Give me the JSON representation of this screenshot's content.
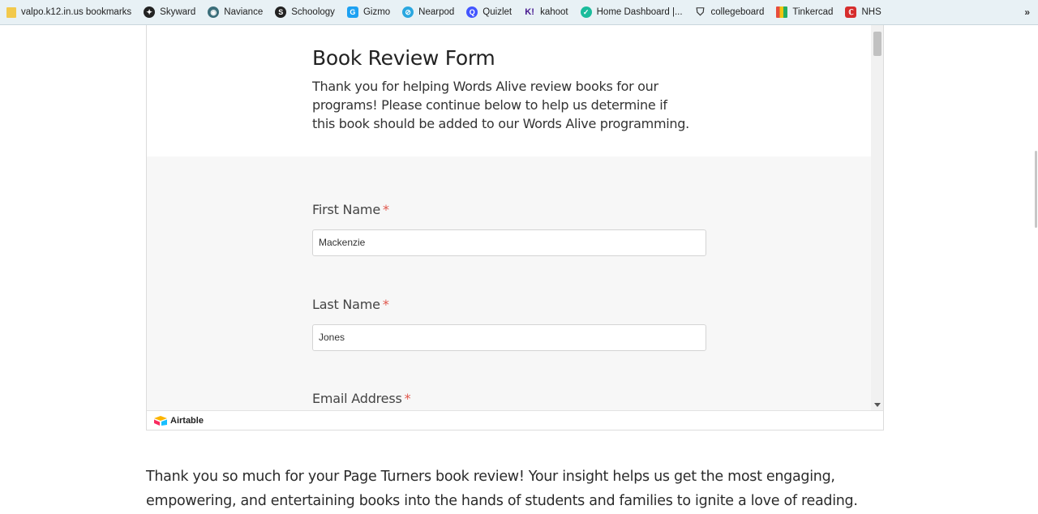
{
  "bookmarks": [
    {
      "label": "valpo.k12.in.us bookmarks",
      "icon": "folder-icon",
      "color": "#f2c94c",
      "glyph": ""
    },
    {
      "label": "Skyward",
      "icon": "skyward-icon",
      "color": "#222222",
      "glyph": "✦"
    },
    {
      "label": "Naviance",
      "icon": "naviance-icon",
      "color": "#3b6e7a",
      "glyph": "◉"
    },
    {
      "label": "Schoology",
      "icon": "schoology-icon",
      "color": "#222222",
      "glyph": "S"
    },
    {
      "label": "Gizmo",
      "icon": "gizmo-icon",
      "color": "#1da1f2",
      "glyph": "G"
    },
    {
      "label": "Nearpod",
      "icon": "nearpod-icon",
      "color": "#2aa7e0",
      "glyph": "⊘"
    },
    {
      "label": "Quizlet",
      "icon": "quizlet-icon",
      "color": "#4255ff",
      "glyph": "Q"
    },
    {
      "label": "kahoot",
      "icon": "kahoot-icon",
      "color": "#46178f",
      "glyph": "K!"
    },
    {
      "label": "Home Dashboard |...",
      "icon": "dashboard-icon",
      "color": "#1abc9c",
      "glyph": "✓"
    },
    {
      "label": "collegeboard",
      "icon": "collegeboard-icon",
      "color": "#333333",
      "glyph": "⛉"
    },
    {
      "label": "Tinkercad",
      "icon": "tinkercad-icon",
      "color": "#e74c3c",
      "glyph": "▦"
    },
    {
      "label": "NHS",
      "icon": "nhs-icon",
      "color": "#d62d2d",
      "glyph": "ℂ"
    }
  ],
  "bookmarks_more": "»",
  "form": {
    "title": "Book Review Form",
    "description": "Thank you for helping Words Alive review books for our programs! Please continue below to help us determine if this book should be added to our Words Alive programming.",
    "required_mark": "*",
    "fields": {
      "first_name": {
        "label": "First Name",
        "value": "Mackenzie"
      },
      "last_name": {
        "label": "Last Name",
        "value": "Jones"
      },
      "email": {
        "label": "Email Address"
      }
    }
  },
  "footer": {
    "brand": "Airtable"
  },
  "page_text": "Thank you so much for your Page Turners book review! Your insight helps us get the most engaging, empowering, and entertaining books into the hands of students and families to ignite a love of reading."
}
